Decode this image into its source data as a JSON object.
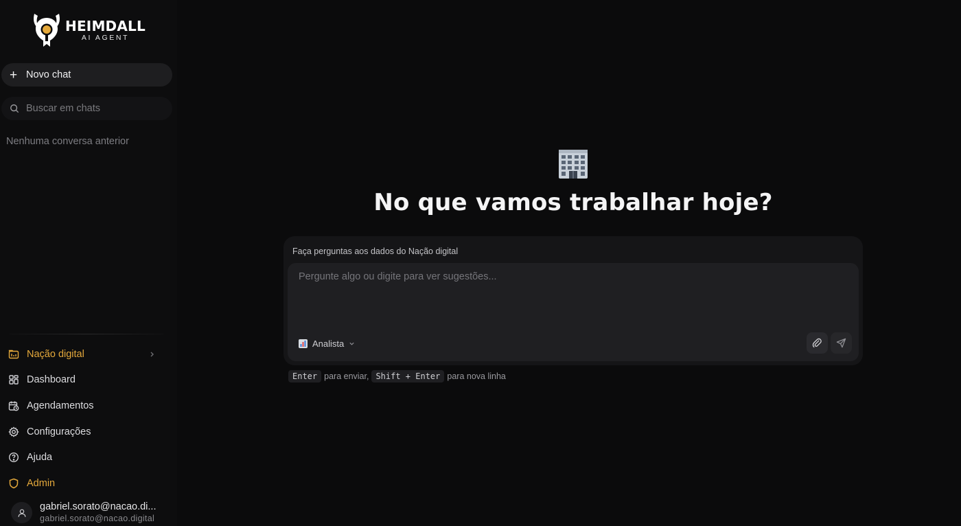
{
  "brand": {
    "name": "HEIMDALL",
    "tagline": "AI AGENT"
  },
  "sidebar": {
    "new_chat_label": "Novo chat",
    "search_placeholder": "Buscar em chats",
    "empty_history": "Nenhuma conversa anterior",
    "nav": [
      {
        "label": "Nação digital",
        "icon": "building-icon",
        "accent": true
      },
      {
        "label": "Dashboard",
        "icon": "grid-icon"
      },
      {
        "label": "Agendamentos",
        "icon": "calendar-clock-icon"
      },
      {
        "label": "Configurações",
        "icon": "gear-icon"
      },
      {
        "label": "Ajuda",
        "icon": "help-circle-icon"
      },
      {
        "label": "Admin",
        "icon": "shield-icon",
        "accent": true
      }
    ],
    "user": {
      "name": "gabriel.sorato@nacao.di...",
      "email": "gabriel.sorato@nacao.digital"
    }
  },
  "main": {
    "title": "No que vamos trabalhar hoje?",
    "hero_icon": "office-building-emoji",
    "composer": {
      "caption": "Faça perguntas aos dados do Nação digital",
      "placeholder": "Pergunte algo ou digite para ver sugestões...",
      "mode_label": "Analista"
    },
    "hints": {
      "enter_key": "Enter",
      "enter_text": "para enviar,",
      "shift_key": "Shift + Enter",
      "shift_text": "para nova linha"
    }
  },
  "colors": {
    "background": "#0b0b0c",
    "sidebar": "#0d0d0e",
    "accent": "#e5a93b"
  }
}
